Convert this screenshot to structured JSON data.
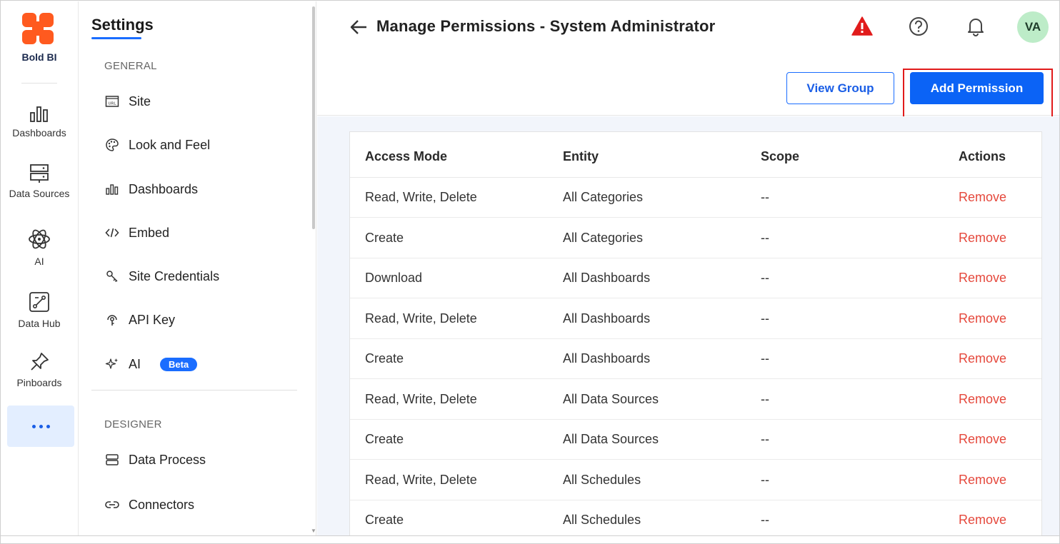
{
  "app": {
    "brand_name": "Bold BI",
    "brand_colors": [
      "#ff5a1f",
      "#ffffff"
    ]
  },
  "rail": {
    "items": [
      {
        "label": "Dashboards",
        "icon": "bar-chart-icon"
      },
      {
        "label": "Data Sources",
        "icon": "server-icon"
      },
      {
        "label": "AI",
        "icon": "atom-icon"
      },
      {
        "label": "Data Hub",
        "icon": "data-hub-icon"
      },
      {
        "label": "Pinboards",
        "icon": "pin-icon"
      }
    ],
    "more_icon": "more-dots-icon"
  },
  "settings": {
    "title": "Settings",
    "general_label": "GENERAL",
    "general_items": [
      {
        "label": "Site",
        "icon": "url-icon"
      },
      {
        "label": "Look and Feel",
        "icon": "palette-icon"
      },
      {
        "label": "Dashboards",
        "icon": "bar-chart-icon"
      },
      {
        "label": "Embed",
        "icon": "code-icon"
      },
      {
        "label": "Site Credentials",
        "icon": "key-icon"
      },
      {
        "label": "API Key",
        "icon": "api-key-icon"
      },
      {
        "label": "AI",
        "icon": "sparkle-icon",
        "badge": "Beta"
      }
    ],
    "designer_label": "DESIGNER",
    "designer_items": [
      {
        "label": "Data Process",
        "icon": "data-process-icon"
      },
      {
        "label": "Connectors",
        "icon": "link-icon"
      }
    ]
  },
  "header": {
    "title": "Manage Permissions - System Administrator",
    "avatar_initials": "VA",
    "warning_color": "#e11b1b",
    "view_group_label": "View Group",
    "add_permission_label": "Add Permission",
    "accent_color": "#0b63f6"
  },
  "table": {
    "columns": [
      "Access Mode",
      "Entity",
      "Scope",
      "Actions"
    ],
    "rows": [
      {
        "access_mode": "Read, Write, Delete",
        "entity": "All Categories",
        "scope": "--",
        "action": "Remove"
      },
      {
        "access_mode": "Create",
        "entity": "All Categories",
        "scope": "--",
        "action": "Remove"
      },
      {
        "access_mode": "Download",
        "entity": "All Dashboards",
        "scope": "--",
        "action": "Remove"
      },
      {
        "access_mode": "Read, Write, Delete",
        "entity": "All Dashboards",
        "scope": "--",
        "action": "Remove"
      },
      {
        "access_mode": "Create",
        "entity": "All Dashboards",
        "scope": "--",
        "action": "Remove"
      },
      {
        "access_mode": "Read, Write, Delete",
        "entity": "All Data Sources",
        "scope": "--",
        "action": "Remove"
      },
      {
        "access_mode": "Create",
        "entity": "All Data Sources",
        "scope": "--",
        "action": "Remove"
      },
      {
        "access_mode": "Read, Write, Delete",
        "entity": "All Schedules",
        "scope": "--",
        "action": "Remove"
      },
      {
        "access_mode": "Create",
        "entity": "All Schedules",
        "scope": "--",
        "action": "Remove"
      }
    ],
    "remove_color": "#e5483c"
  }
}
